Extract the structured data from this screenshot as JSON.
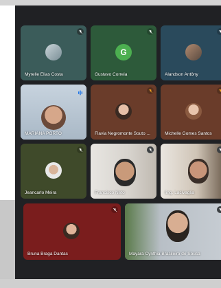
{
  "participants": [
    {
      "name": "Myrelle Elias Costa",
      "tile_color": "#3b5c5a",
      "avatar": "photo",
      "mic": "muted"
    },
    {
      "name": "Gustavo Correia",
      "tile_color": "#2d5a3a",
      "avatar": "letter",
      "letter": "G",
      "letter_color": "#4caf50",
      "mic": "muted"
    },
    {
      "name": "Alandson Antôny",
      "tile_color": "#2a4a5c",
      "avatar": "photo",
      "mic": "muted"
    },
    {
      "name": "MARIANA PORTO",
      "tile_color": "#b9c8d6",
      "avatar": "video",
      "mic": "speaking"
    },
    {
      "name": "Flavia Negromonte Souto ...",
      "tile_color": "#6a3c2a",
      "avatar": "photo",
      "mic": "muted"
    },
    {
      "name": "Michelle Gomes Santos",
      "tile_color": "#6a3c2a",
      "avatar": "photo",
      "mic": "muted"
    },
    {
      "name": "Jeancarlo Meira",
      "tile_color": "#3f4a2a",
      "avatar": "photo",
      "mic": "muted"
    },
    {
      "name": "Francisco Neto",
      "tile_color": "#5c5a55",
      "avatar": "video",
      "mic": "muted"
    },
    {
      "name": "Iing. Lacivaglia",
      "tile_color": "#7a6a5a",
      "avatar": "video",
      "mic": "muted"
    },
    {
      "name": "Bruna Braga Dantas",
      "tile_color": "#7a1d1d",
      "avatar": "photo",
      "mic": "muted"
    },
    {
      "name": "Mayara Cynthia Brasileiro de Sousa",
      "tile_color": "#8a9098",
      "avatar": "video",
      "mic": "muted"
    }
  ],
  "colors": {
    "grid_bg": "#202124",
    "muted_icon": "#3c4043",
    "speaking_icon": "#1a73e8"
  }
}
